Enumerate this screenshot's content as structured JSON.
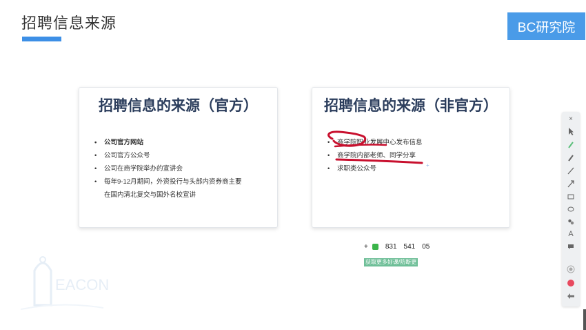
{
  "slide": {
    "title": "招聘信息来源",
    "brand": "BC研究院"
  },
  "card_official": {
    "heading": "招聘信息的来源（官方）",
    "items": [
      "公司官方网站",
      "公司官方公众号",
      "公司在商学院举办的宣讲会",
      "每年9-12月期间，外资投行与头部内资券商主要",
      "在国内清北复交与国外名校宣讲"
    ]
  },
  "card_unofficial": {
    "heading": "招聘信息的来源（非官方）",
    "items": [
      "商学院职业发展中心发布信息",
      "商学院内部老师、同学分享",
      "求职类公众号"
    ]
  },
  "contact": {
    "plus": "+",
    "num1": "831",
    "num2": "541",
    "num3": "05",
    "tagline": "获取更多好课/防断更"
  },
  "watermark": {
    "text": "EACON"
  },
  "toolbar": {
    "icons": [
      "close-icon",
      "pointer-icon",
      "highlighter-icon",
      "pen-icon",
      "line-icon",
      "arrow-icon",
      "rectangle-icon",
      "ellipse-icon",
      "bubbles-icon",
      "text-icon",
      "comment-icon",
      "record-icon",
      "stop-icon",
      "back-icon"
    ]
  },
  "colors": {
    "accent": "#3d8fe6",
    "brand_bg": "#4a9be8",
    "heading": "#2b3d5c",
    "annotation_red": "#c8102e",
    "wechat_green": "#3bb54a",
    "tagline_bg": "#6fbf98"
  }
}
